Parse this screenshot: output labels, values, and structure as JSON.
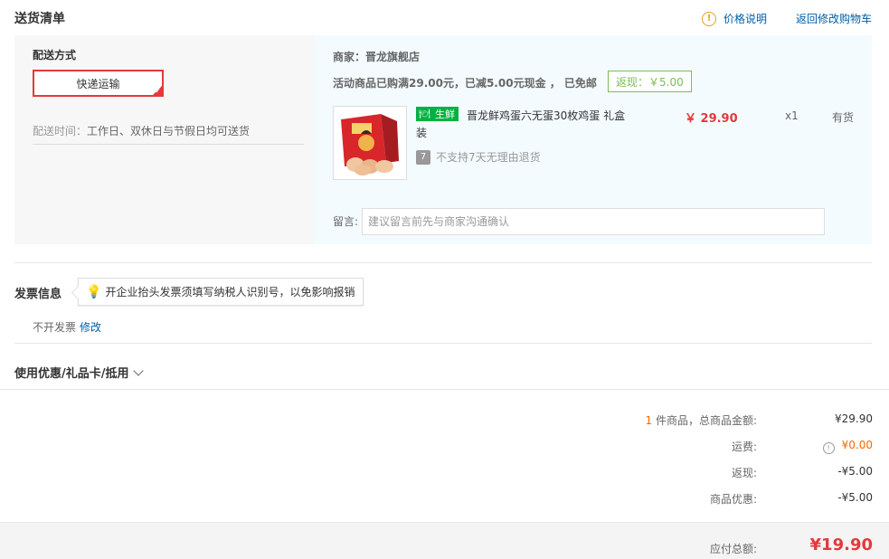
{
  "header": {
    "title": "送货清单",
    "price_help": "价格说明",
    "price_help_icon": "!",
    "back_to_cart": "返回修改购物车"
  },
  "shipping": {
    "label": "配送方式",
    "option": "快递运输",
    "time_label": "配送时间：",
    "time_value": "工作日、双休日与节假日均可送货"
  },
  "merchant": {
    "label": "商家：",
    "name": "晋龙旗舰店"
  },
  "promo": {
    "text": "活动商品已购满29.00元，已减5.00元现金 ， 已免邮",
    "rebate": "返现：￥5.00"
  },
  "product": {
    "tag": "生鲜",
    "name": "晋龙鲜鸡蛋六无蛋30枚鸡蛋 礼盒装",
    "no_return_icon": "7",
    "no_return": "不支持7天无理由退货",
    "price": "￥ 29.90",
    "qty": "x1",
    "stock": "有货"
  },
  "message": {
    "label": "留言:",
    "placeholder": "建议留言前先与商家沟通确认"
  },
  "invoice": {
    "title": "发票信息",
    "tip": "开企业抬头发票须填写纳税人识别号，以免影响报销",
    "status": "不开发票",
    "edit": "修改"
  },
  "coupon": {
    "label": "使用优惠/礼品卡/抵用"
  },
  "summary": {
    "count": "1",
    "items_label": " 件商品，总商品金额:",
    "items_total": "¥29.90",
    "shipping_label": "运费:",
    "shipping_icon": "!",
    "shipping_value": "¥0.00",
    "rebate_label": "返现:",
    "rebate_value": "-¥5.00",
    "discount_label": "商品优惠:",
    "discount_value": "-¥5.00",
    "payable_label": "应付总额:",
    "payable_value": "¥19.90"
  },
  "colors": {
    "accent_red": "#e4393c",
    "link_blue": "#005ea7",
    "fresh_green": "#00b140",
    "rebate_green": "#7abd54"
  }
}
